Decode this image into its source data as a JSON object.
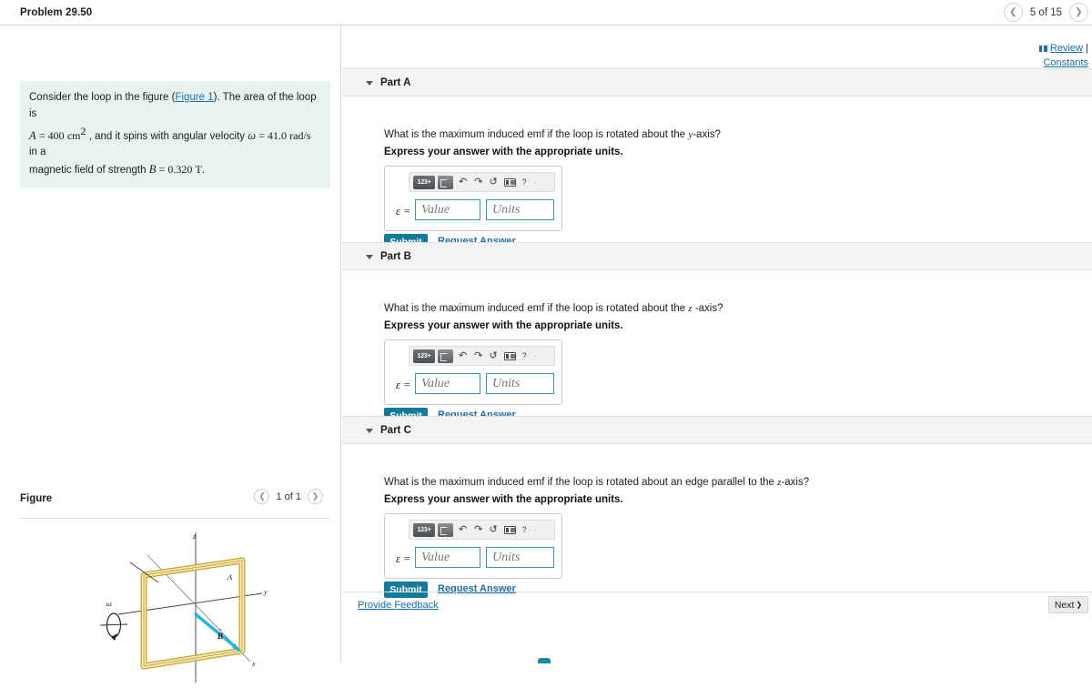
{
  "header": {
    "problem_title": "Problem 29.50",
    "pager": {
      "prev_icon": "chevron-left-icon",
      "label": "5 of 15",
      "next_icon": "chevron-right-icon"
    }
  },
  "sidebar": {
    "statement": {
      "intro": "Consider the loop in the figure (",
      "figure_link": "Figure 1",
      "after_link": "). The area of the loop is",
      "area_symbol": "A",
      "area_eq": "= 400",
      "area_unit": "cm",
      "area_exp": "2",
      "spins_text": ", and it spins with angular velocity",
      "omega_symbol": "ω",
      "omega_eq": "= 41.0",
      "omega_unit": "rad/s",
      "in_a": "in a",
      "field_text": "magnetic field of strength",
      "b_symbol": "B",
      "b_eq": "= 0.320",
      "b_unit": "T",
      "period": "."
    },
    "figure": {
      "label": "Figure",
      "pager": {
        "prev_icon": "chevron-left-icon",
        "label": "1 of 1",
        "next_icon": "chevron-right-icon"
      },
      "axis_z": "z",
      "axis_y": "y",
      "axis_x": "x",
      "label_A": "A",
      "label_B": "B",
      "label_omega": "ω",
      "loop_color": "#f5e3a8",
      "loop_edge_color": "#c9a227",
      "b_vector_color": "#25b4e0"
    }
  },
  "review": {
    "icon": "book-icon",
    "review_label": "Review",
    "separator": "|",
    "constants_label": "Constants"
  },
  "toolbar": {
    "numeric_chip": "123+",
    "template_chip_icon": "template-icon",
    "undo_icon": "↶",
    "redo_icon": "↷",
    "reset_icon": "↺",
    "keyboard_icon": "keyboard-icon",
    "help_icon": "?",
    "more_icon": "·"
  },
  "answer": {
    "epsilon_label": "ε  =",
    "value_placeholder": "Value",
    "units_placeholder": "Units",
    "submit_label": "Submit",
    "request_label": "Request Answer"
  },
  "parts": [
    {
      "id": "part-a",
      "title": "Part A",
      "question_prefix": "What is the maximum induced emf if the loop is rotated about the",
      "question_axis": "y",
      "question_suffix": "-axis?",
      "instruction": "Express your answer with the appropriate units."
    },
    {
      "id": "part-b",
      "title": "Part B",
      "question_prefix": "What is the maximum induced emf if the loop is rotated about the",
      "question_axis": "z",
      "question_suffix": "-axis?",
      "instruction": "Express your answer with the appropriate units."
    },
    {
      "id": "part-c",
      "title": "Part C",
      "question_prefix": "What is the maximum induced emf if the loop is rotated about an edge parallel to the",
      "question_axis": "z",
      "question_suffix": "-axis?",
      "instruction": "Express your answer with the appropriate units."
    }
  ],
  "footer": {
    "provide_feedback": "Provide Feedback",
    "next_label": "Next",
    "next_icon": "❯"
  },
  "colors": {
    "accent_teal": "#127a9a",
    "link_blue": "#1b6ea8",
    "statement_bg": "#e7f3f1",
    "part_header_bg": "#f4f4f4",
    "input_border": "#3a93ad"
  }
}
